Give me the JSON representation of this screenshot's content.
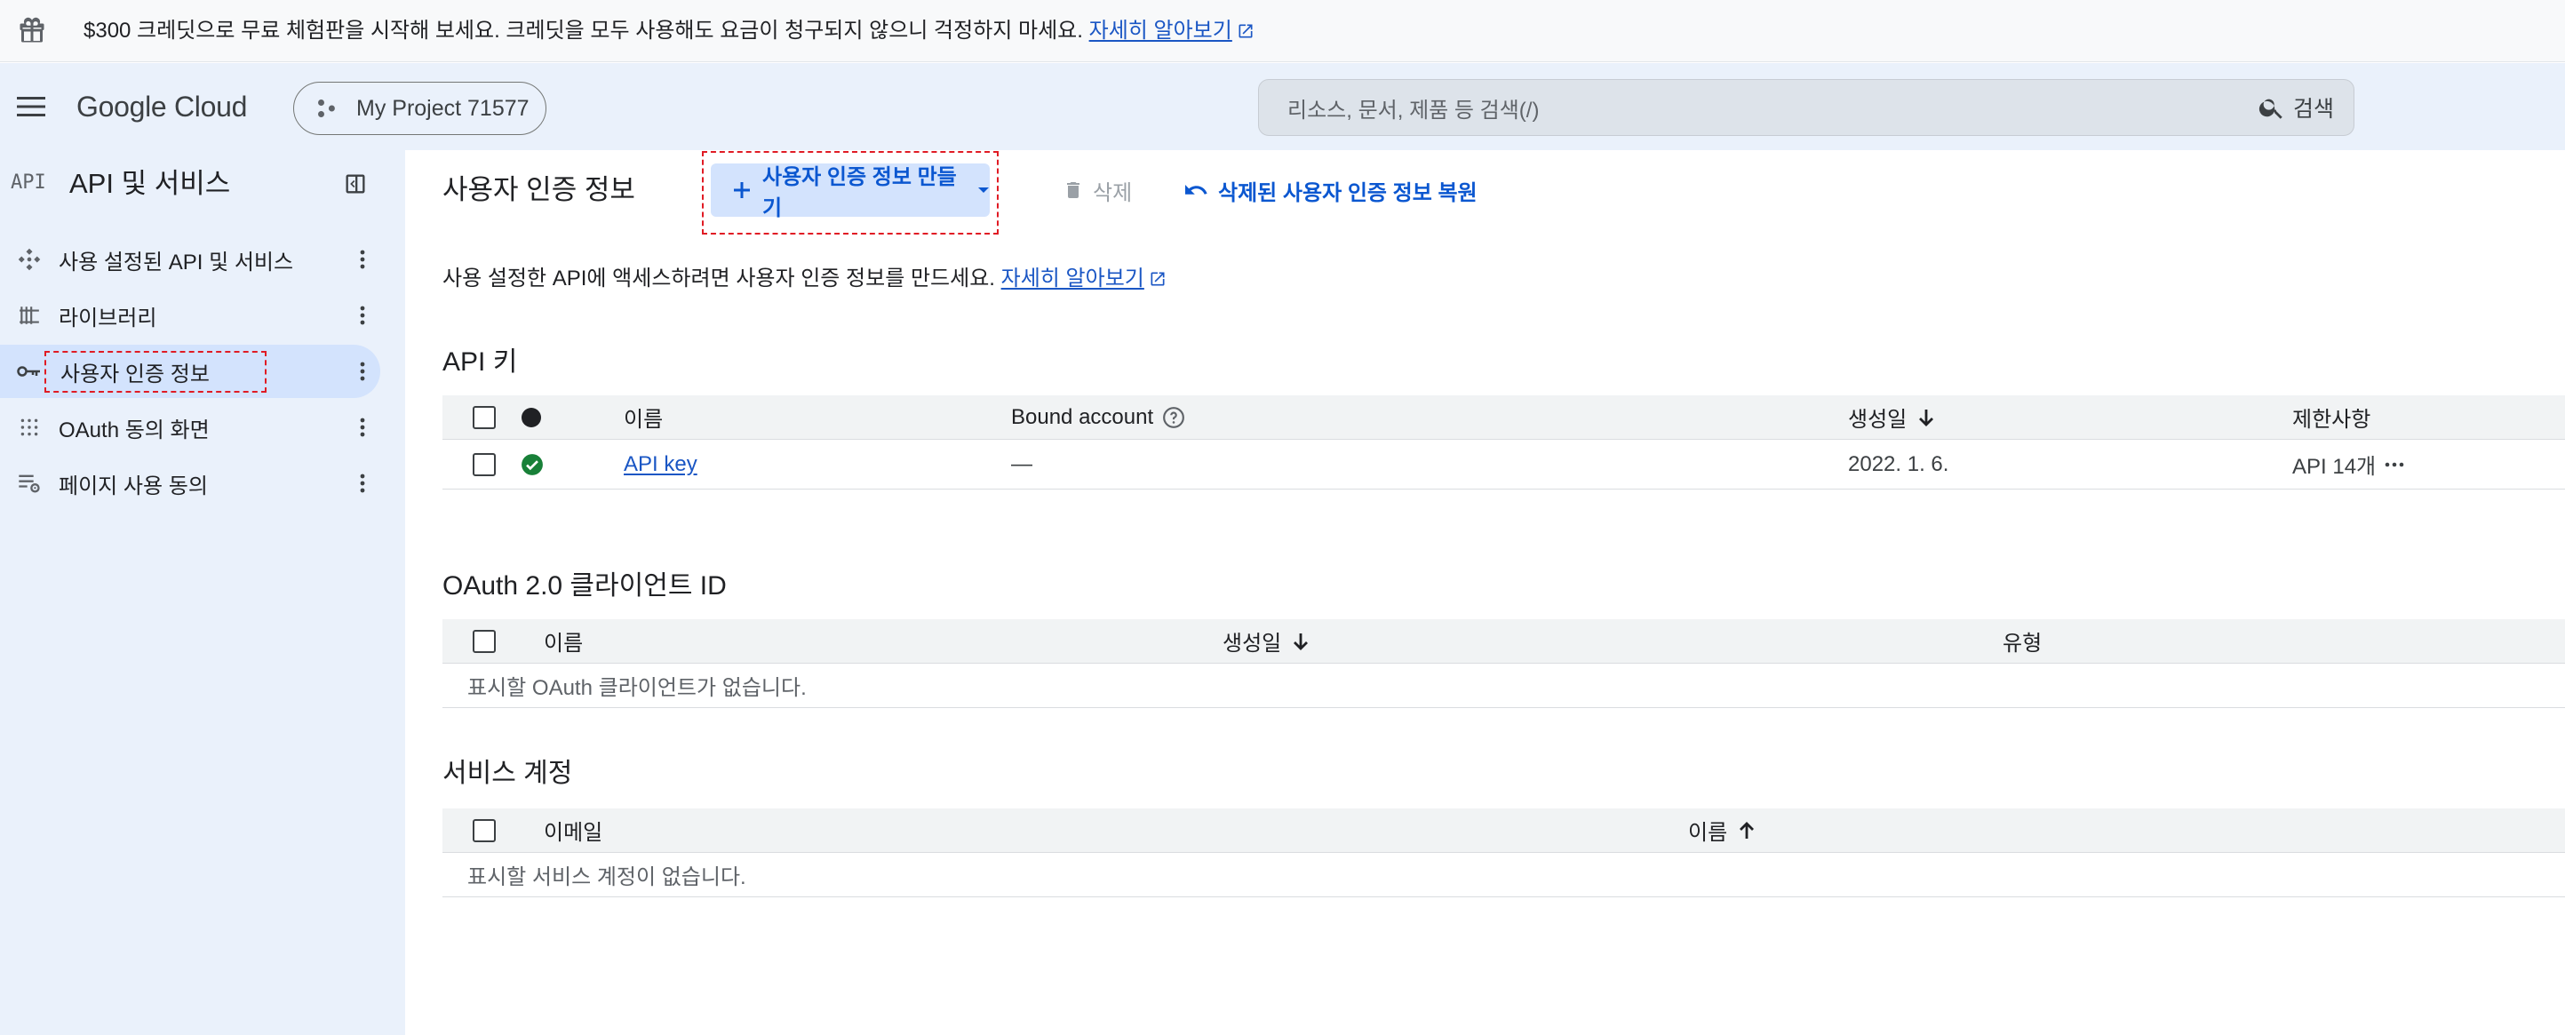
{
  "banner": {
    "text": "$300 크레딧으로 무료 체험판을 시작해 보세요. 크레딧을 모두 사용해도 요금이 청구되지 않으니 걱정하지 마세요.",
    "link": "자세히 알아보기"
  },
  "topbar": {
    "logo": "Google Cloud",
    "project": "My Project 71577",
    "search_placeholder": "리소스, 문서, 제품 등 검색(/)",
    "search_button": "검색"
  },
  "sidebar": {
    "badge": "API",
    "title": "API 및 서비스",
    "items": [
      {
        "label": "사용 설정된 API 및 서비스",
        "icon": "api-diamond-icon"
      },
      {
        "label": "라이브러리",
        "icon": "library-icon"
      },
      {
        "label": "사용자 인증 정보",
        "icon": "key-icon",
        "active": true
      },
      {
        "label": "OAuth 동의 화면",
        "icon": "oauth-dots-icon"
      },
      {
        "label": "페이지 사용 동의",
        "icon": "page-settings-icon"
      }
    ]
  },
  "toolbar": {
    "title": "사용자 인증 정보",
    "create_label": "사용자 인증 정보 만들기",
    "delete_label": "삭제",
    "restore_label": "삭제된 사용자 인증 정보 복원"
  },
  "intro": {
    "text": "사용 설정한 API에 액세스하려면 사용자 인증 정보를 만드세요.",
    "link": "자세히 알아보기"
  },
  "api_keys": {
    "title": "API 키",
    "columns": [
      "이름",
      "Bound account",
      "생성일",
      "제한사항"
    ],
    "rows": [
      {
        "name": "API key",
        "bound_account": "—",
        "created": "2022. 1. 6.",
        "restrictions": "API 14개",
        "status": "enabled"
      }
    ]
  },
  "oauth": {
    "title": "OAuth 2.0 클라이언트 ID",
    "columns": [
      "이름",
      "생성일",
      "유형"
    ],
    "empty": "표시할 OAuth 클라이언트가 없습니다."
  },
  "service_accounts": {
    "title": "서비스 계정",
    "columns": [
      "이메일",
      "이름"
    ],
    "empty": "표시할 서비스 계정이 없습니다."
  },
  "colors": {
    "accent": "#0b57d0",
    "nav_bg": "#eaf1fb",
    "active_bg": "#d3e3fd",
    "highlight": "#e01b24",
    "success": "#188038"
  }
}
